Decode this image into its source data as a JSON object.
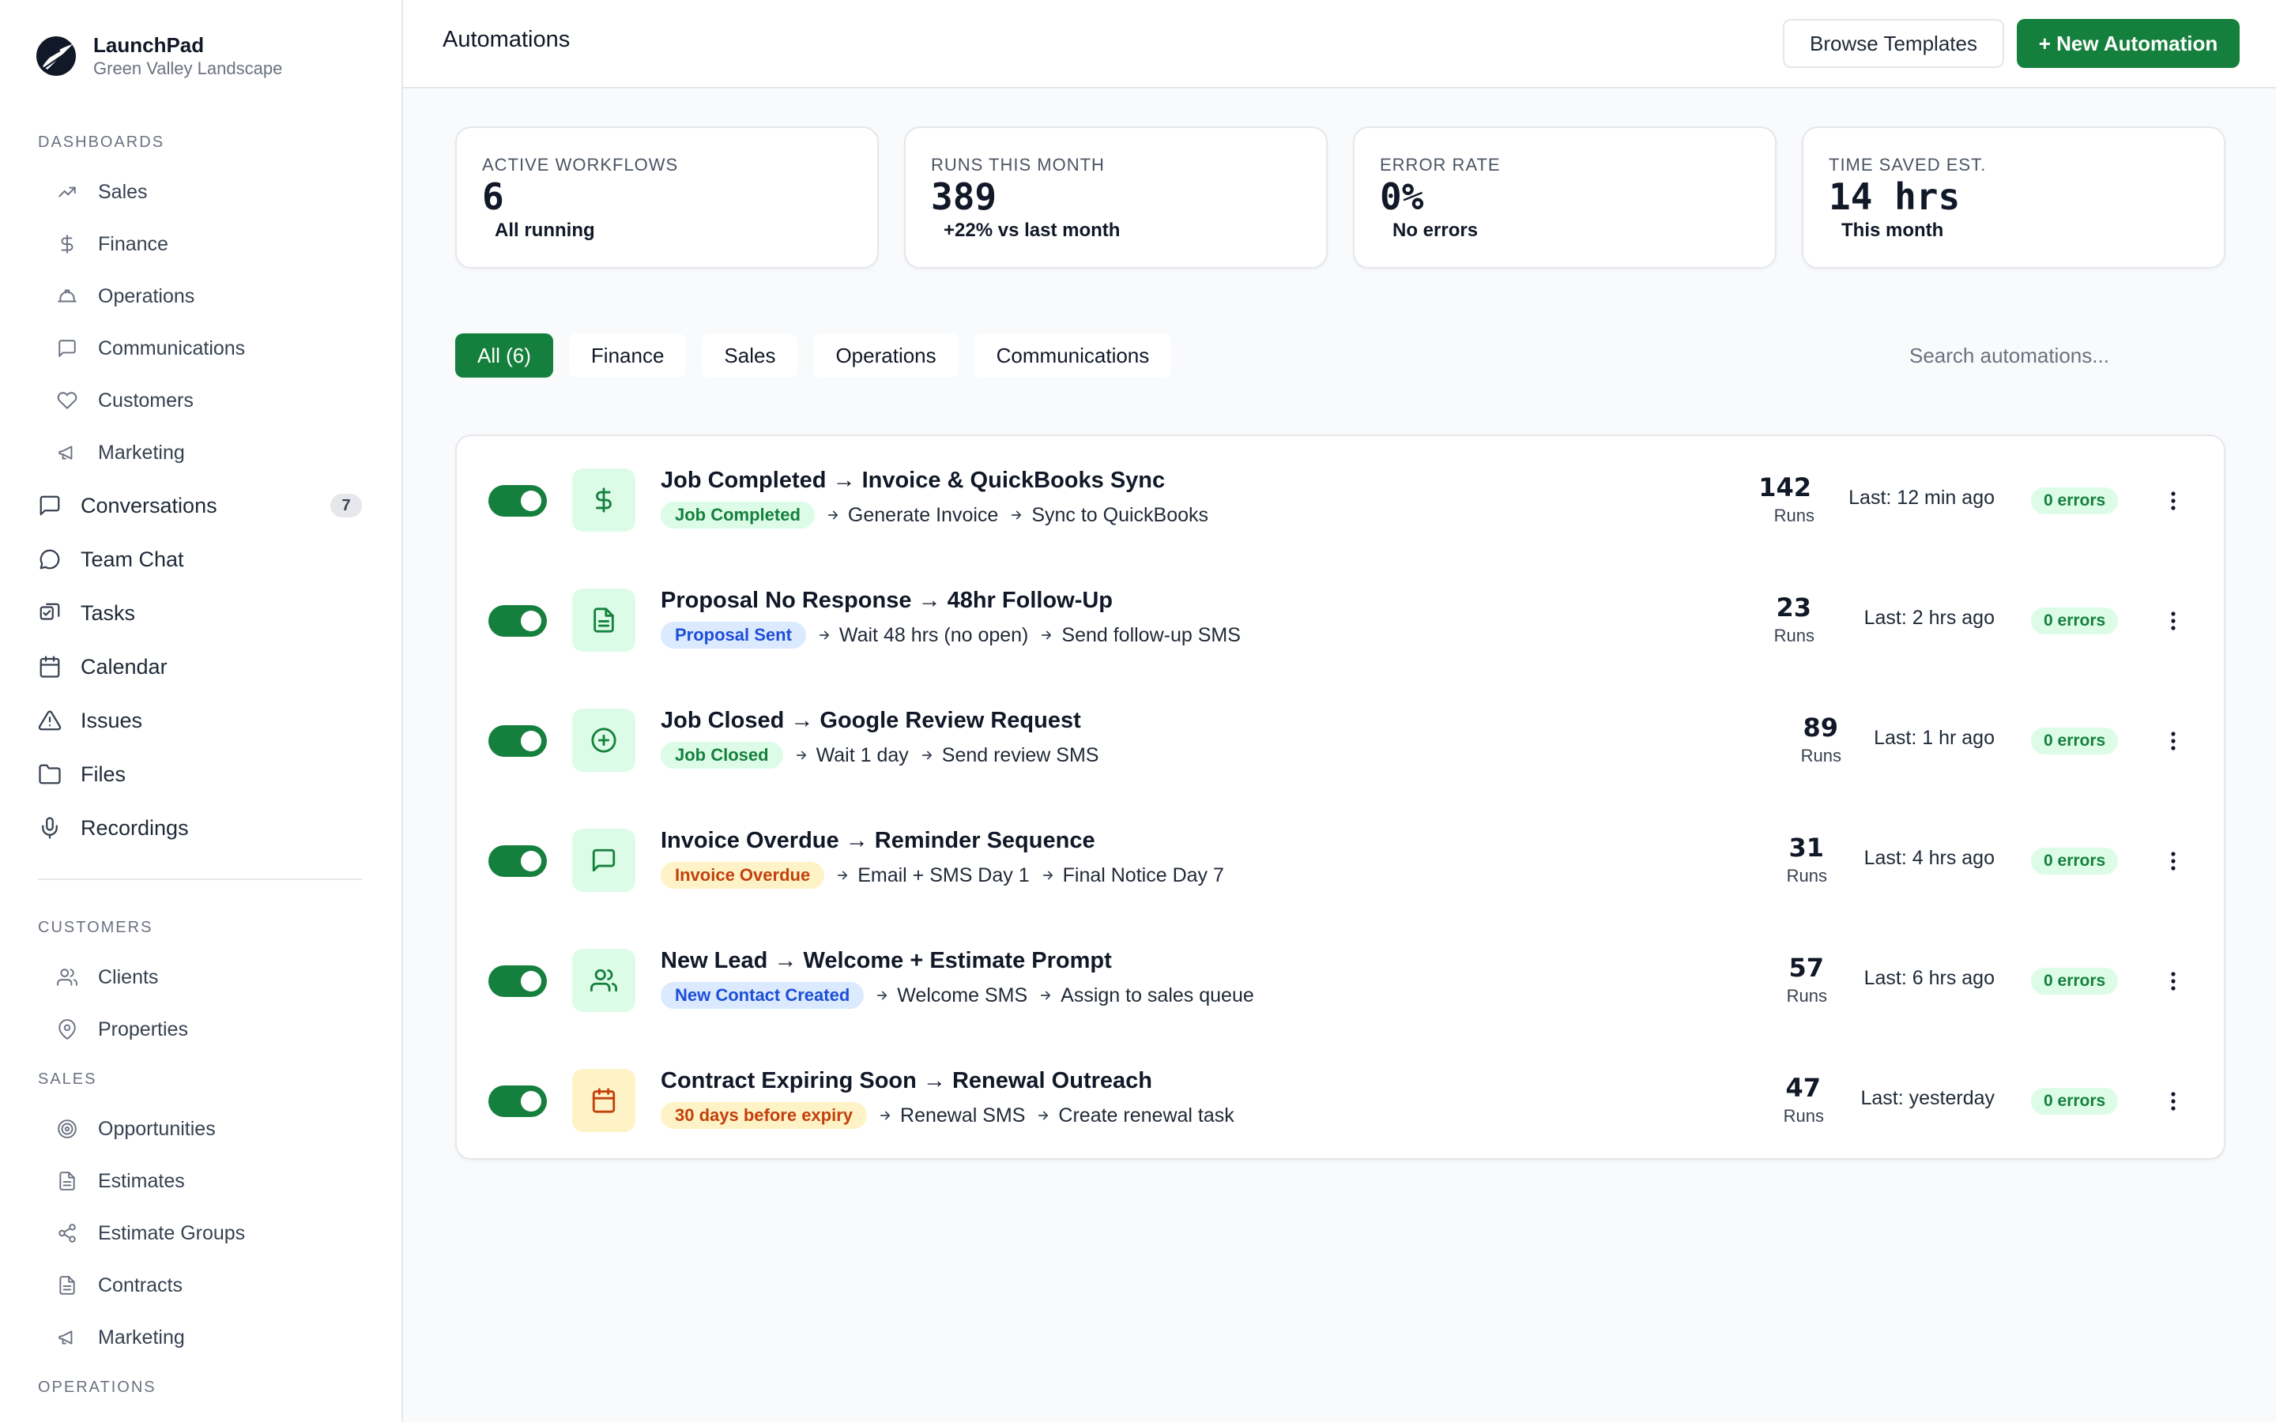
{
  "brand": {
    "name": "LaunchPad",
    "subtitle": "Green Valley Landscape"
  },
  "sidebar": {
    "dashboards_label": "DASHBOARDS",
    "dashboards": [
      {
        "label": "Sales",
        "icon": "trending-up-icon"
      },
      {
        "label": "Finance",
        "icon": "dollar-icon"
      },
      {
        "label": "Operations",
        "icon": "hardhat-icon"
      },
      {
        "label": "Communications",
        "icon": "message-square-icon"
      },
      {
        "label": "Customers",
        "icon": "heart-icon"
      },
      {
        "label": "Marketing",
        "icon": "megaphone-icon"
      }
    ],
    "top_items": [
      {
        "label": "Conversations",
        "icon": "message-square-icon",
        "badge": "7"
      },
      {
        "label": "Team Chat",
        "icon": "message-circle-icon"
      },
      {
        "label": "Tasks",
        "icon": "tasks-icon"
      },
      {
        "label": "Calendar",
        "icon": "calendar-icon"
      },
      {
        "label": "Issues",
        "icon": "alert-triangle-icon"
      },
      {
        "label": "Files",
        "icon": "folder-icon"
      },
      {
        "label": "Recordings",
        "icon": "mic-icon"
      }
    ],
    "customers_label": "CUSTOMERS",
    "customers": [
      {
        "label": "Clients",
        "icon": "users-icon"
      },
      {
        "label": "Properties",
        "icon": "map-pin-icon"
      }
    ],
    "sales_label": "SALES",
    "sales": [
      {
        "label": "Opportunities",
        "icon": "target-icon"
      },
      {
        "label": "Estimates",
        "icon": "file-icon"
      },
      {
        "label": "Estimate Groups",
        "icon": "share-icon"
      },
      {
        "label": "Contracts",
        "icon": "file-icon"
      },
      {
        "label": "Marketing",
        "icon": "megaphone-icon"
      }
    ],
    "operations_label": "OPERATIONS"
  },
  "header": {
    "title": "Automations",
    "browse_label": "Browse Templates",
    "new_label": "+ New Automation"
  },
  "stats": [
    {
      "label": "ACTIVE WORKFLOWS",
      "value": "6",
      "sub": "All running"
    },
    {
      "label": "RUNS THIS MONTH",
      "value": "389",
      "sub": "+22% vs last month"
    },
    {
      "label": "ERROR RATE",
      "value": "0%",
      "sub": "No errors"
    },
    {
      "label": "TIME SAVED EST.",
      "value": "14 hrs",
      "sub": "This month"
    }
  ],
  "filters": {
    "chips": [
      "All (6)",
      "Finance",
      "Sales",
      "Operations",
      "Communications"
    ],
    "active_index": 0,
    "search_placeholder": "Search automations..."
  },
  "runs_label": "Runs",
  "automations": [
    {
      "title": "Job Completed → Invoice & QuickBooks Sync",
      "trigger": "Job Completed",
      "trigger_style": "green",
      "steps": [
        "Generate Invoice",
        "Sync to QuickBooks"
      ],
      "runs": "142",
      "last": "Last: 12 min ago",
      "errors": "0 errors",
      "icon": "dollar-icon",
      "icon_style": "green",
      "enabled": true
    },
    {
      "title": "Proposal No Response → 48hr Follow-Up",
      "trigger": "Proposal Sent",
      "trigger_style": "blue",
      "steps": [
        "Wait 48 hrs (no open)",
        "Send follow-up SMS"
      ],
      "runs": "23",
      "last": "Last: 2 hrs ago",
      "errors": "0 errors",
      "icon": "file-icon",
      "icon_style": "green",
      "enabled": true
    },
    {
      "title": "Job Closed → Google Review Request",
      "trigger": "Job Closed",
      "trigger_style": "green",
      "steps": [
        "Wait 1 day",
        "Send review SMS"
      ],
      "runs": "89",
      "last": "Last: 1 hr ago",
      "errors": "0 errors",
      "icon": "plus-circle-icon",
      "icon_style": "green",
      "enabled": true
    },
    {
      "title": "Invoice Overdue → Reminder Sequence",
      "trigger": "Invoice Overdue",
      "trigger_style": "orange",
      "steps": [
        "Email + SMS Day 1",
        "Final Notice Day 7"
      ],
      "runs": "31",
      "last": "Last: 4 hrs ago",
      "errors": "0 errors",
      "icon": "message-square-icon",
      "icon_style": "green",
      "enabled": true
    },
    {
      "title": "New Lead → Welcome + Estimate Prompt",
      "trigger": "New Contact Created",
      "trigger_style": "blue",
      "steps": [
        "Welcome SMS",
        "Assign to sales queue"
      ],
      "runs": "57",
      "last": "Last: 6 hrs ago",
      "errors": "0 errors",
      "icon": "users-icon",
      "icon_style": "green",
      "enabled": true
    },
    {
      "title": "Contract Expiring Soon → Renewal Outreach",
      "trigger": "30 days before expiry",
      "trigger_style": "orange",
      "steps": [
        "Renewal SMS",
        "Create renewal task"
      ],
      "runs": "47",
      "last": "Last: yesterday",
      "errors": "0 errors",
      "icon": "calendar-icon",
      "icon_style": "orange",
      "enabled": true
    }
  ],
  "colors": {
    "accent": "#15803d",
    "green_bg": "#dcfce7",
    "green_fg": "#15803d",
    "blue_bg": "#dbeafe",
    "blue_fg": "#1d4ed8",
    "orange_bg": "#fef3c7",
    "orange_fg": "#c2410c"
  }
}
